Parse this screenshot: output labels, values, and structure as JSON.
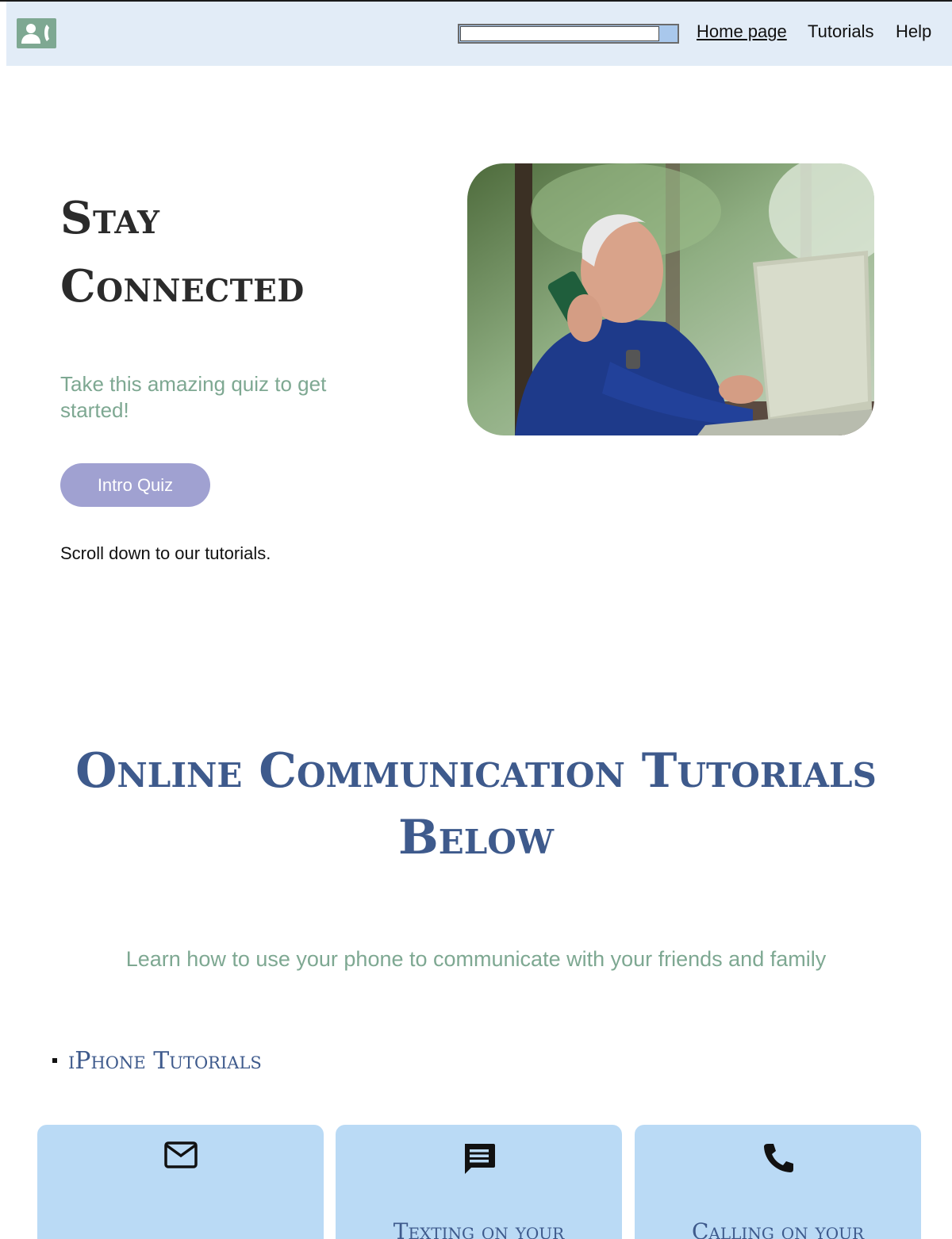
{
  "header": {
    "logo_icon": "contact-phone-icon",
    "search": {
      "value": "",
      "placeholder": ""
    },
    "nav": {
      "home": "Home page",
      "tutorials": "Tutorials",
      "help": "Help"
    }
  },
  "hero": {
    "title": "Stay Connected",
    "subtitle": "Take this amazing quiz to get started!",
    "quiz_button": "Intro Quiz",
    "scroll_note": "Scroll down to our tutorials.",
    "image_icon": "man-on-phone-with-laptop-photo"
  },
  "tutorials": {
    "title": "Online Communication Tutorials Below",
    "subtitle": "Learn how to use your phone to communicate with your friends and family",
    "list_heading": "iPhone Tutorials",
    "cards": [
      {
        "icon": "mail-icon",
        "title": ""
      },
      {
        "icon": "message-icon",
        "title": "Texting on your"
      },
      {
        "icon": "phone-icon",
        "title": "Calling on your"
      }
    ]
  },
  "colors": {
    "header_bg": "#e2ecf7",
    "accent_green": "#7ea892",
    "button_purple": "#a0a1d1",
    "heading_blue": "#3e5a8c",
    "card_bg": "#badaf5"
  }
}
